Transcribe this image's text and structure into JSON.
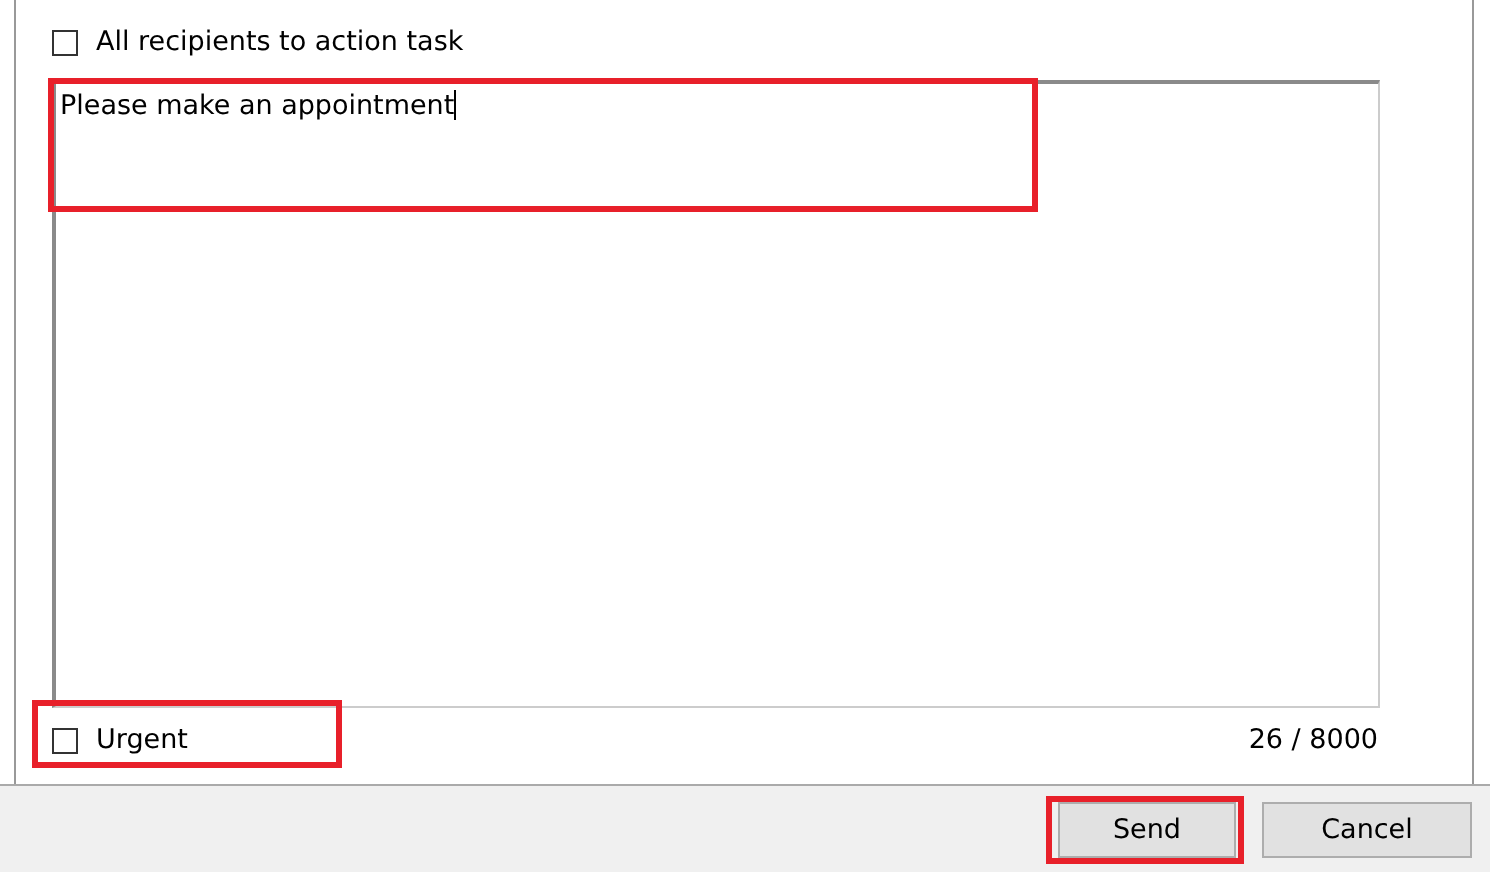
{
  "all_recipients": {
    "label": "All recipients to action task",
    "checked": false
  },
  "message": {
    "value": "Please make an appointment",
    "highlighted": true
  },
  "urgent": {
    "label": "Urgent",
    "checked": false,
    "highlighted": true
  },
  "char_count": "26 / 8000",
  "buttons": [
    {
      "label": "Send",
      "highlighted": true
    },
    {
      "label": "Cancel",
      "highlighted": false
    }
  ]
}
